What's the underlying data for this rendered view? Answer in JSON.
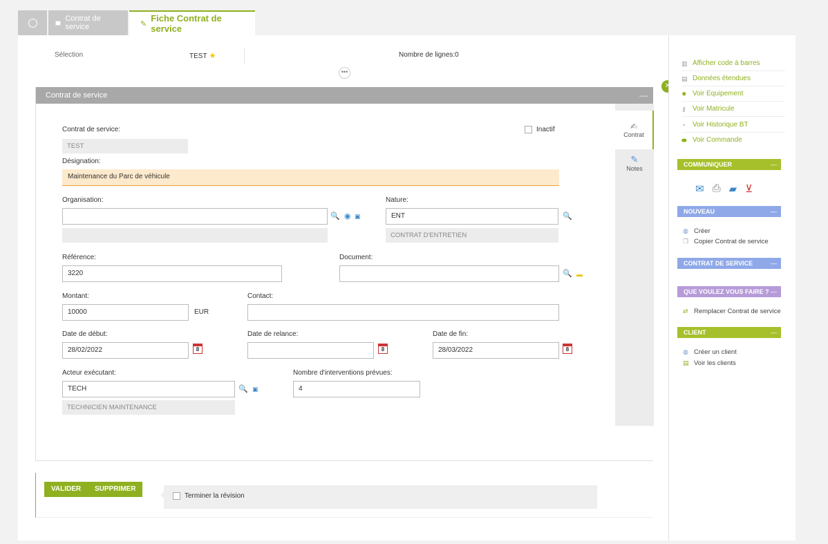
{
  "tabs": [
    {
      "label": ""
    },
    {
      "label": "Contrat de service"
    },
    {
      "label": "Fiche Contrat de service"
    }
  ],
  "selection": {
    "label": "Sélection",
    "value": "TEST",
    "lines": "Nombre de lignes:0"
  },
  "panel": {
    "title": "Contrat de service"
  },
  "side_tabs": [
    {
      "label": "Contrat"
    },
    {
      "label": "Notes"
    }
  ],
  "form": {
    "contrat_label": "Contrat de service:",
    "contrat_value": "TEST",
    "inactif_label": "Inactif",
    "designation_label": "Désignation:",
    "designation_value": "Maintenance du Parc de véhicule",
    "organisation_label": "Organisation:",
    "organisation_value": "",
    "nature_label": "Nature:",
    "nature_value": "ENT",
    "nature_desc": "CONTRAT D'ENTRETIEN",
    "reference_label": "Référence:",
    "reference_value": "3220",
    "document_label": "Document:",
    "document_value": "",
    "montant_label": "Montant:",
    "montant_value": "10000",
    "montant_unit": "EUR",
    "contact_label": "Contact:",
    "contact_value": "",
    "date_debut_label": "Date de début:",
    "date_debut_value": "28/02/2022",
    "date_relance_label": "Date de relance:",
    "date_relance_value": "",
    "date_fin_label": "Date de fin:",
    "date_fin_value": "28/03/2022",
    "acteur_label": "Acteur exécutant:",
    "acteur_value": "TECH",
    "acteur_desc": "TECHNICIEN MAINTENANCE",
    "interventions_label": "Nombre d'interventions prévues:",
    "interventions_value": "4",
    "cal_day": "8"
  },
  "actions": {
    "valider": "VALIDER",
    "supprimer": "SUPPRIMER",
    "terminer": "Terminer la révision"
  },
  "right": {
    "links": [
      {
        "label": "Afficher code à barres"
      },
      {
        "label": "Données étendues"
      },
      {
        "label": "Voir Equipement"
      },
      {
        "label": "Voir Matricule"
      },
      {
        "label": "Voir Historique BT"
      },
      {
        "label": "Voir Commande"
      }
    ],
    "communiquer": "COMMUNIQUER",
    "nouveau": "NOUVEAU",
    "nouveau_items": [
      {
        "label": "Créer"
      },
      {
        "label": "Copier Contrat de service"
      }
    ],
    "contrat_service": "CONTRAT DE SERVICE",
    "que_voulez": "QUE VOULEZ VOUS FAIRE ?",
    "que_items": [
      {
        "label": "Remplacer Contrat de service"
      }
    ],
    "client": "CLIENT",
    "client_items": [
      {
        "label": "Créer un client"
      },
      {
        "label": "Voir les clients"
      }
    ]
  }
}
